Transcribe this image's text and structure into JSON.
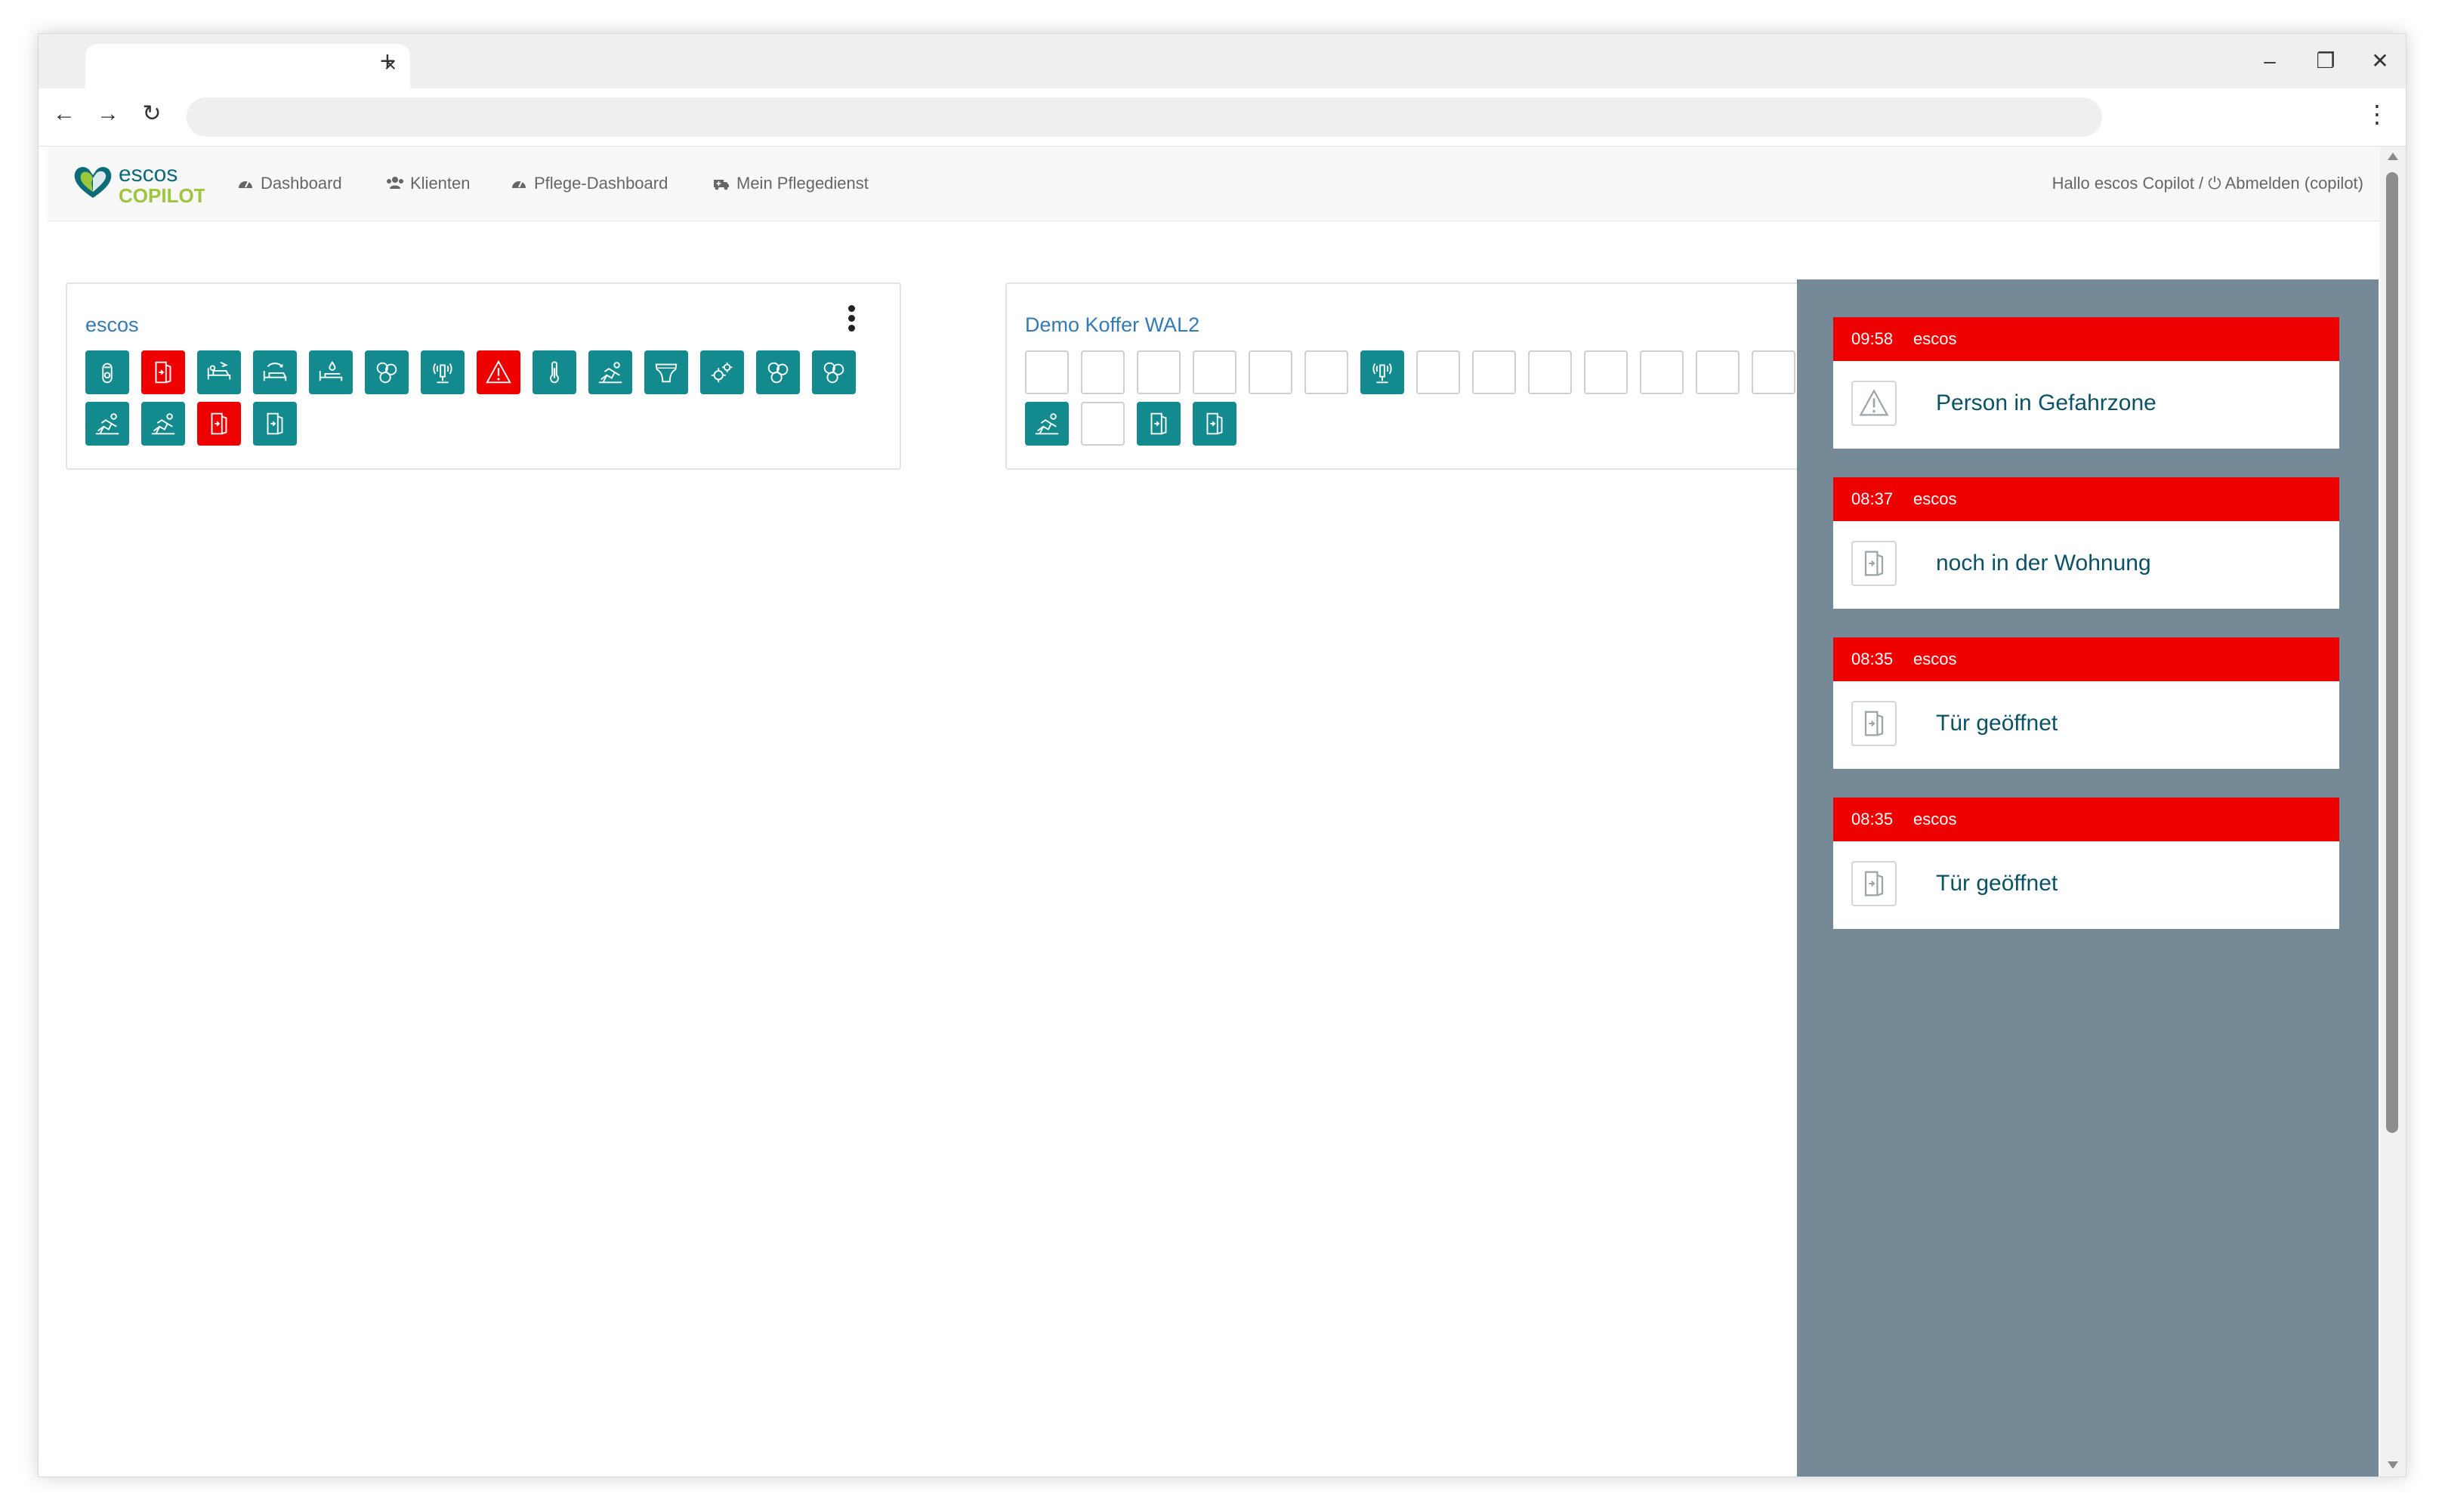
{
  "browser": {
    "tab_close": "×",
    "new_tab": "+",
    "minimize": "–",
    "maximize": "❐",
    "close": "✕",
    "back": "←",
    "forward": "→",
    "reload": "↻",
    "menu": "⋮"
  },
  "app": {
    "logo": {
      "line1": "escos",
      "line2": "COPILOT"
    },
    "nav": {
      "dashboard": "Dashboard",
      "klienten": "Klienten",
      "pflege_dashboard": "Pflege-Dashboard",
      "mein_pflegedienst": "Mein Pflegedienst"
    },
    "greeting": "Hallo escos Copilot / ⏻ Abmelden (copilot)"
  },
  "cards": [
    {
      "title": "escos"
    },
    {
      "title": "Demo Koffer WAL2"
    }
  ],
  "alerts": [
    {
      "time": "09:58",
      "source": "escos",
      "message": "Person in Gefahrzone",
      "icon": "warning-icon"
    },
    {
      "time": "08:37",
      "source": "escos",
      "message": "noch in der Wohnung",
      "icon": "door-icon"
    },
    {
      "time": "08:35",
      "source": "escos",
      "message": "Tür geöffnet",
      "icon": "door-icon"
    },
    {
      "time": "08:35",
      "source": "escos",
      "message": "Tür geöffnet",
      "icon": "door-icon"
    }
  ],
  "colors": {
    "teal": "#138a8e",
    "red": "#ee0000",
    "link": "#337ab7",
    "panel": "#758a96"
  }
}
